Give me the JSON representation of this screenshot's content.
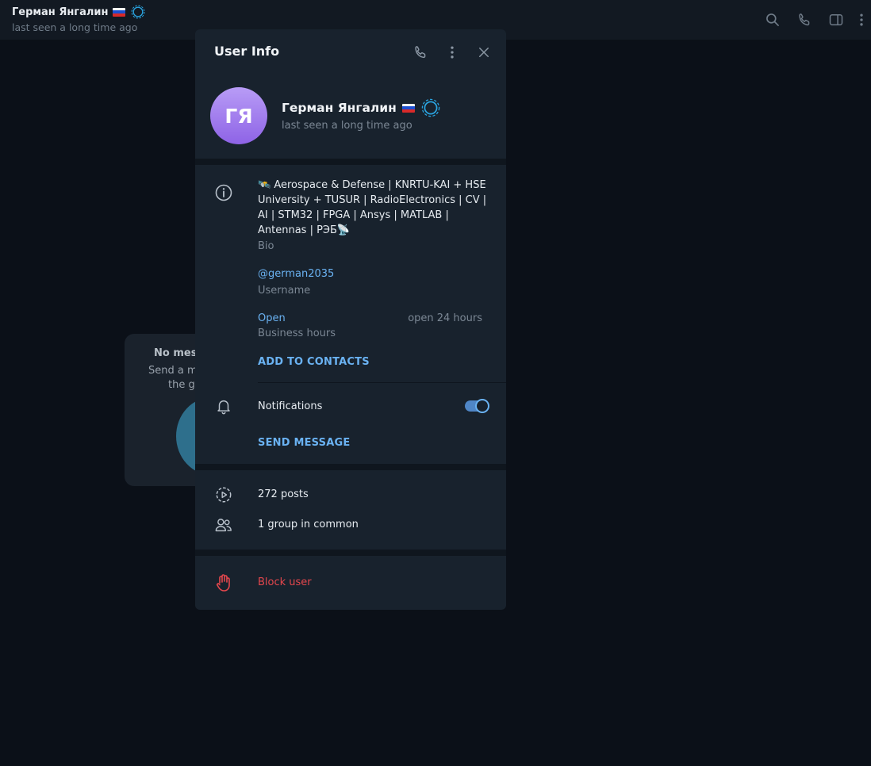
{
  "topbar": {
    "name": "Герман Янгалин",
    "status": "last seen a long time ago",
    "icons": [
      "search-icon",
      "phone-icon",
      "sidebar-toggle-icon",
      "more-vertical-icon"
    ]
  },
  "background_card": {
    "line1": "No mess",
    "line2": "Send a me",
    "line3": "the gr"
  },
  "modal": {
    "title": "User Info",
    "header_icons": [
      "phone-icon",
      "more-vertical-icon",
      "close-icon"
    ],
    "avatar_initials": "ГЯ",
    "name": "Герман Янгалин",
    "status": "last seen a long time ago",
    "bio": "🛰️ Aerospace & Defense | KNRTU-KAI + HSE University + TUSUR | RadioElectronics | CV | AI | STM32 | FPGA | Ansys | MATLAB | Antennas | РЭБ📡",
    "bio_label": "Bio",
    "username": "@german2035",
    "username_label": "Username",
    "business_status": "Open",
    "business_hours_value": "open 24 hours",
    "business_hours_label": "Business hours",
    "add_to_contacts": "ADD TO CONTACTS",
    "notifications_label": "Notifications",
    "notifications_on": true,
    "send_message": "SEND MESSAGE",
    "posts": "272 posts",
    "groups_in_common": "1 group in common",
    "block_user": "Block user"
  },
  "colors": {
    "accent": "#6ab2f2",
    "danger": "#e5474d",
    "panel": "#18222d",
    "background": "#0b1018"
  }
}
